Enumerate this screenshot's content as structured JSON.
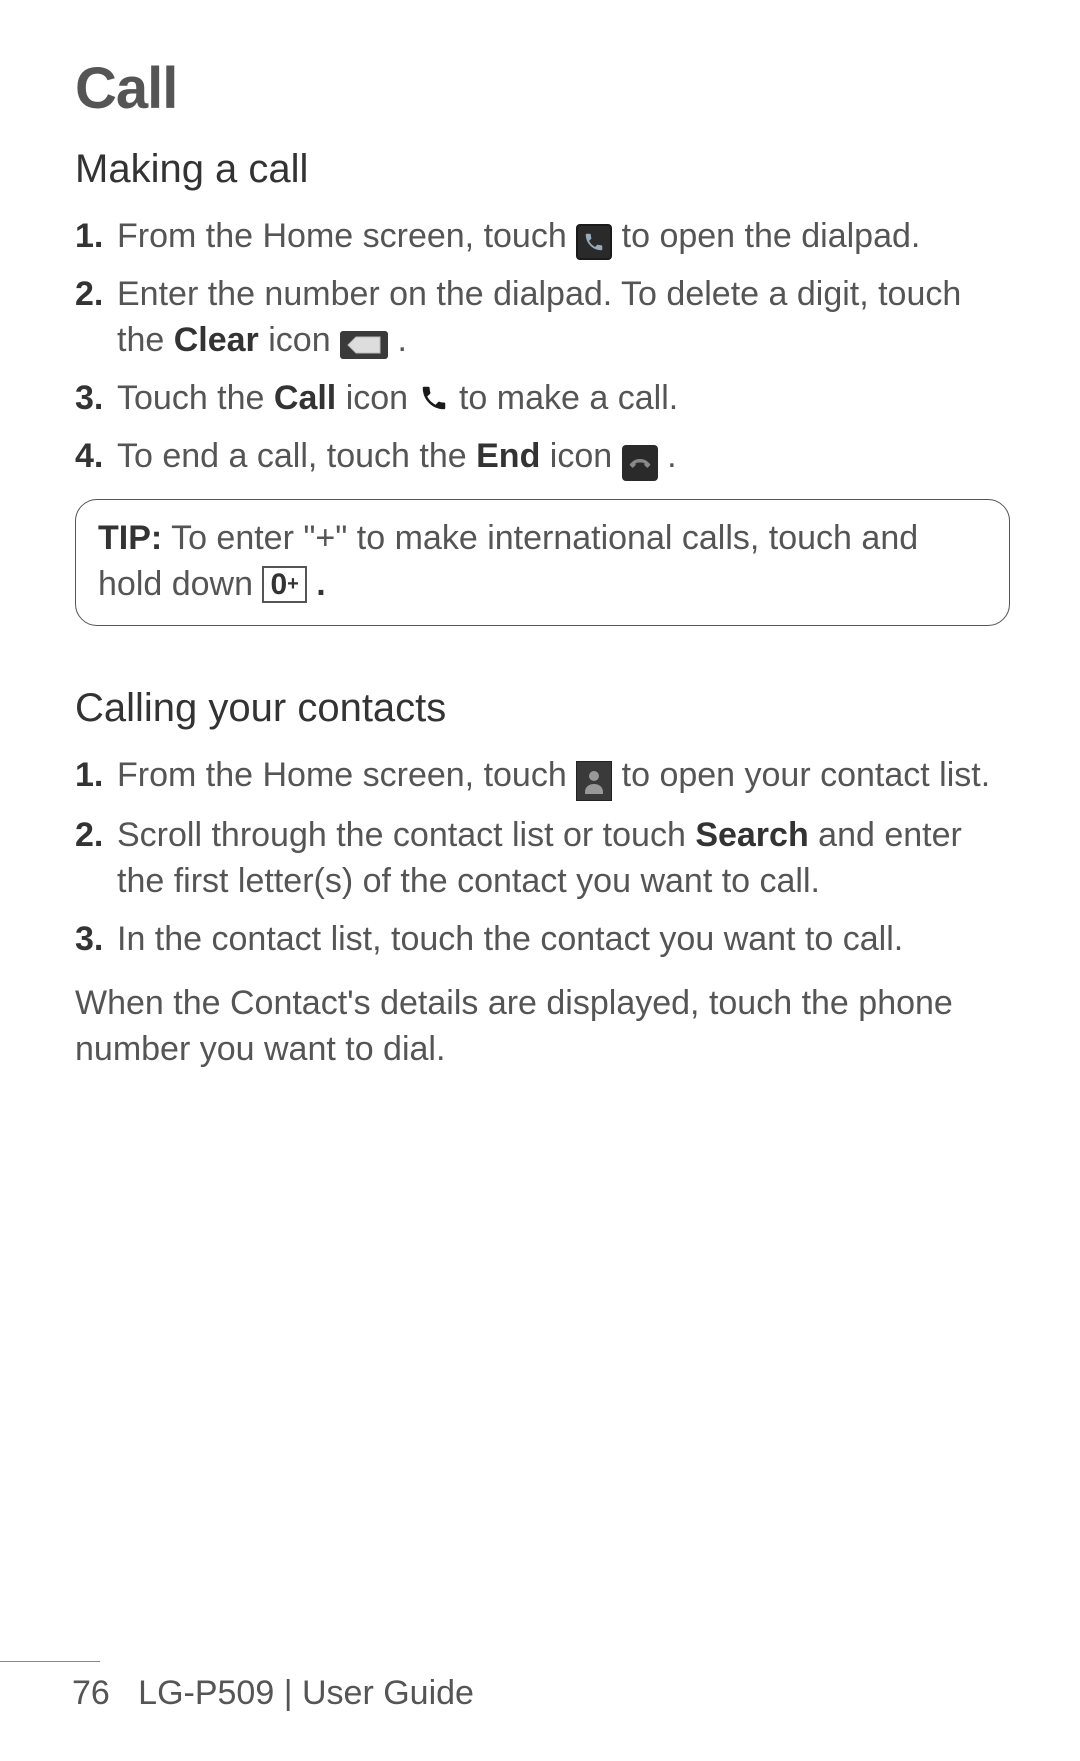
{
  "title": "Call",
  "section1": {
    "heading": "Making a call",
    "steps": [
      {
        "num": "1.",
        "pre": " From the Home screen, touch ",
        "icon": "phone-app-icon",
        "post": " to open the dialpad."
      },
      {
        "num": "2.",
        "pre": "Enter the number on the dialpad. To delete a digit, touch the ",
        "bold": "Clear",
        "mid": " icon ",
        "icon": "backspace-icon",
        "post": " ."
      },
      {
        "num": "3.",
        "pre": "Touch the ",
        "bold": "Call",
        "mid": " icon ",
        "icon": "call-icon",
        "post": " to make a call."
      },
      {
        "num": "4.",
        "pre": "To end a call, touch the ",
        "bold": "End",
        "mid": " icon ",
        "icon": "end-call-icon",
        "post": "."
      }
    ]
  },
  "tip": {
    "label": "TIP:",
    "text1": " To enter \"+\" to make international calls, touch and hold down ",
    "key": "0",
    "keyPlus": "+",
    "text2": "."
  },
  "section2": {
    "heading": "Calling your contacts",
    "steps": [
      {
        "num": "1.",
        "pre": " From the Home screen, touch ",
        "icon": "contacts-icon",
        "post": " to open your contact list."
      },
      {
        "num": "2.",
        "pre": "Scroll through the contact list or touch ",
        "bold": "Search",
        "post": " and enter the first letter(s) of the contact you want to call."
      },
      {
        "num": "3.",
        "pre": "In the contact list, touch the contact you want to call."
      }
    ],
    "closing": "When the Contact's details are displayed, touch the phone number you want to dial."
  },
  "footer": {
    "page": "76",
    "model": "LG-P509",
    "sep": "  |  ",
    "guide": "User Guide"
  }
}
